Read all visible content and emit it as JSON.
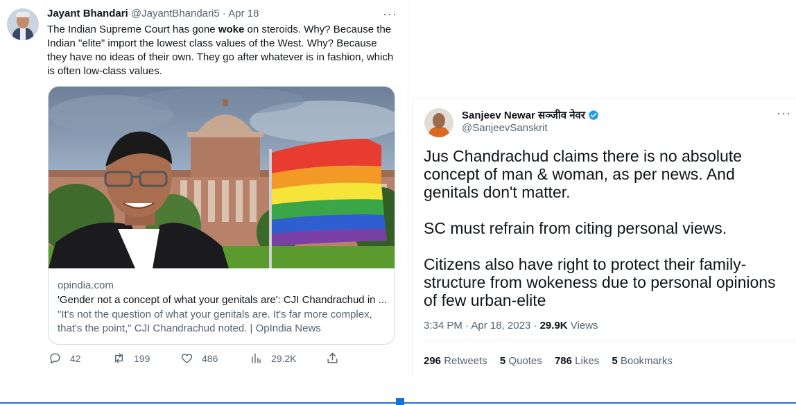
{
  "left_tweet": {
    "name": "Jayant Bhandari",
    "handle": "@JayantBhandari5",
    "separator": "·",
    "date": "Apr 18",
    "more": "···",
    "text_before": "The Indian Supreme Court has gone ",
    "text_bold": "woke",
    "text_after": " on steroids. Why? Because the Indian \"elite\" import the lowest class values of the West. Why? Because they have no ideas of their own. They go after whatever is in fashion, which is often low-class values.",
    "card": {
      "domain": "opindia.com",
      "title": "'Gender not a concept of what your genitals are': CJI Chandrachud in ...",
      "description": "\"It's not the question of what your genitals are. It's far more complex, that's the point,\" CJI Chandrachud noted. | OpIndia News"
    },
    "actions": {
      "replies": "42",
      "retweets": "199",
      "likes": "486",
      "views": "29.2K"
    },
    "icons": [
      "reply-icon",
      "retweet-icon",
      "like-icon",
      "views-icon",
      "share-icon"
    ]
  },
  "right_tweet": {
    "name": "Sanjeev Newar सञ्जीव नेवर",
    "handle": "@SanjeevSanskrit",
    "more": "···",
    "paragraphs": [
      "Jus Chandrachud claims there is no absolute concept of man & woman, as per news. And genitals don't matter.",
      "SC must refrain from citing personal views.",
      "Citizens also have right to protect their family-structure from wokeness due to personal opinions of few urban-elite"
    ],
    "timestamp": "3:34 PM · Apr 18, 2023 · ",
    "views_count": "29.9K",
    "views_label": " Views",
    "stats": {
      "retweets_count": "296",
      "retweets_label": " Retweets",
      "quotes_count": "5",
      "quotes_label": " Quotes",
      "likes_count": "786",
      "likes_label": " Likes",
      "bookmarks_count": "5",
      "bookmarks_label": " Bookmarks"
    }
  },
  "colors": {
    "text_primary": "#0f1419",
    "text_secondary": "#536471",
    "border": "#cfd9de",
    "verified": "#1d9bf0"
  }
}
